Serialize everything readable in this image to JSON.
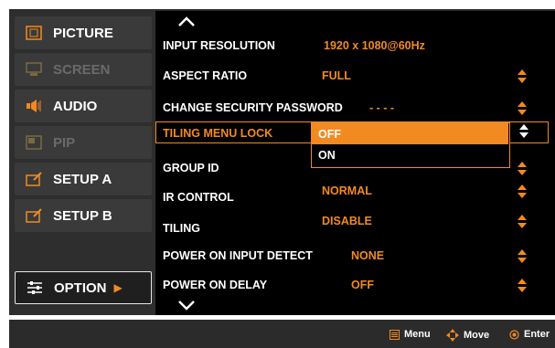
{
  "sidebar": {
    "items": [
      {
        "label": "PICTURE",
        "icon": "picture-icon"
      },
      {
        "label": "SCREEN",
        "icon": "screen-icon"
      },
      {
        "label": "AUDIO",
        "icon": "audio-icon"
      },
      {
        "label": "PIP",
        "icon": "pip-icon"
      },
      {
        "label": "SETUP A",
        "icon": "setup-icon"
      },
      {
        "label": "SETUP B",
        "icon": "setup-icon"
      },
      {
        "label": "OPTION",
        "icon": "option-icon",
        "arrow": "▶"
      }
    ]
  },
  "rows": [
    {
      "label": "INPUT RESOLUTION",
      "value": "1920 x 1080@60Hz"
    },
    {
      "label": "ASPECT RATIO",
      "value": "FULL"
    },
    {
      "label": "CHANGE SECURITY PASSWORD",
      "value": "- - - -"
    },
    {
      "label": "TILING MENU LOCK"
    },
    {
      "label": "GROUP ID"
    },
    {
      "label": "IR CONTROL",
      "value": "NORMAL"
    },
    {
      "label": "TILING",
      "value": "DISABLE"
    },
    {
      "label": "POWER ON INPUT DETECT",
      "value": "NONE"
    },
    {
      "label": "POWER ON DELAY",
      "value": "OFF"
    }
  ],
  "dropdown": {
    "options": [
      "OFF",
      "ON"
    ],
    "selected": "OFF"
  },
  "footer": {
    "menu": "Menu",
    "move": "Move",
    "enter": "Enter"
  },
  "colors": {
    "accent": "#f28a22",
    "panel": "#2b2b2b",
    "main": "#000000"
  }
}
